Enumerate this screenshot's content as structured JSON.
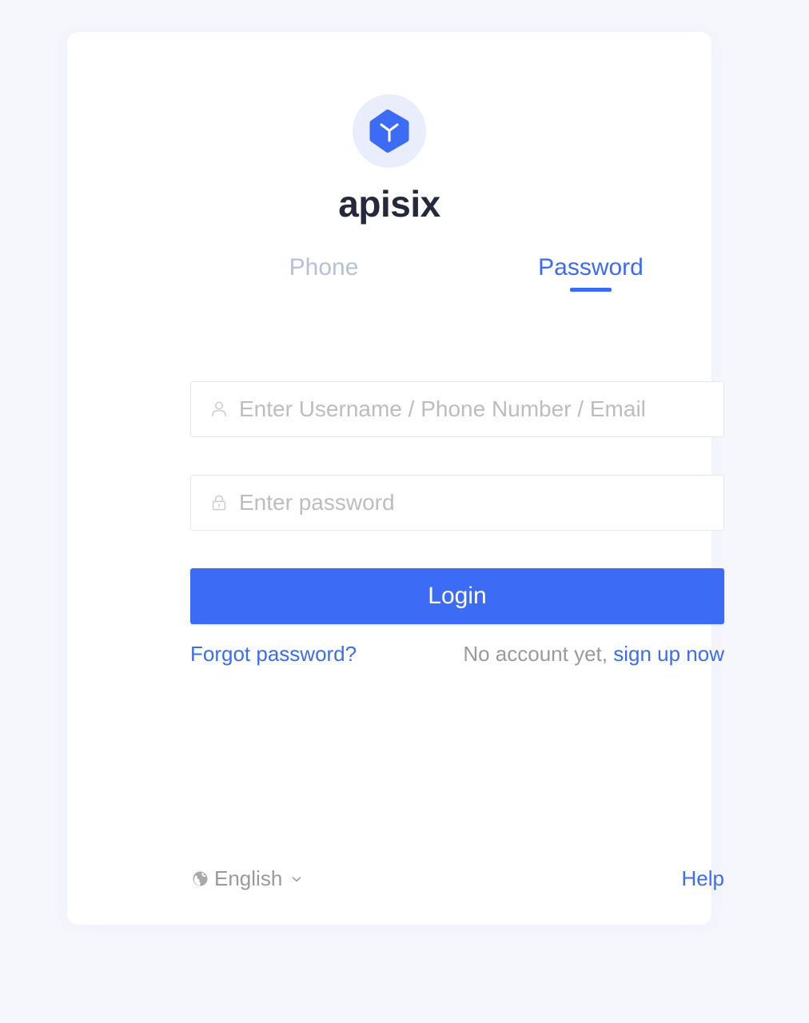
{
  "theme": {
    "page_background": "#f6f7fd",
    "card_background": "#ffffff",
    "accent_blue": "#3c6cf5",
    "logo_circle_background": "#eaeefc",
    "brand_text_color": "#242a3c",
    "inactive_tab_color": "#b7c0d8",
    "placeholder_color": "#bdbdbf",
    "muted_text_color": "#9a9a9d",
    "input_border_color": "#e6e6e8"
  },
  "brand": {
    "logo_icon": "hexagon-y-logo-icon",
    "name": "apisix"
  },
  "tabs": [
    {
      "id": "phone",
      "label": "Phone",
      "active": false
    },
    {
      "id": "password",
      "label": "Password",
      "active": true
    }
  ],
  "form": {
    "username": {
      "icon": "user-icon",
      "value": "",
      "placeholder": "Enter Username / Phone Number / Email"
    },
    "password": {
      "icon": "lock-icon",
      "value": "",
      "placeholder": "Enter password"
    },
    "submit_label": "Login"
  },
  "links": {
    "forgot_password": "Forgot password?",
    "no_account_text": "No account yet,",
    "sign_up": "sign up now"
  },
  "footer": {
    "language_icon": "globe-icon",
    "language": "English",
    "chevron": "chevron-down-icon",
    "help": "Help"
  }
}
